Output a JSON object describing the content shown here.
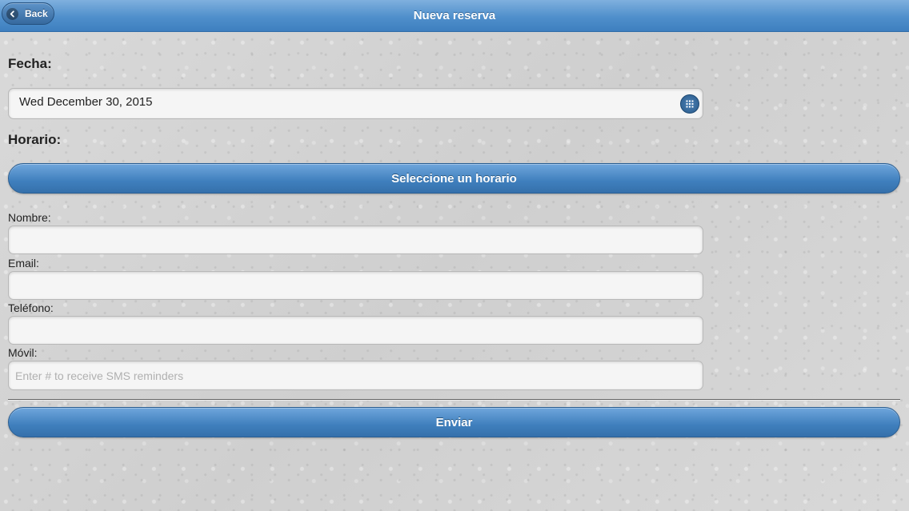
{
  "header": {
    "title": "Nueva reserva",
    "back_label": "Back"
  },
  "form": {
    "fecha_label": "Fecha:",
    "fecha_value": "Wed December 30, 2015",
    "horario_label": "Horario:",
    "horario_button": "Seleccione un horario",
    "nombre_label": "Nombre:",
    "nombre_value": "",
    "email_label": "Email:",
    "email_value": "",
    "telefono_label": "Teléfono:",
    "telefono_value": "",
    "movil_label": "Móvil:",
    "movil_value": "",
    "movil_placeholder": "Enter # to receive SMS reminders",
    "submit_label": "Enviar"
  },
  "icons": {
    "back": "chevron-left-icon",
    "calendar": "calendar-grid-icon"
  },
  "colors": {
    "accent": "#3f7fbd",
    "header": "#4f8fcb"
  }
}
